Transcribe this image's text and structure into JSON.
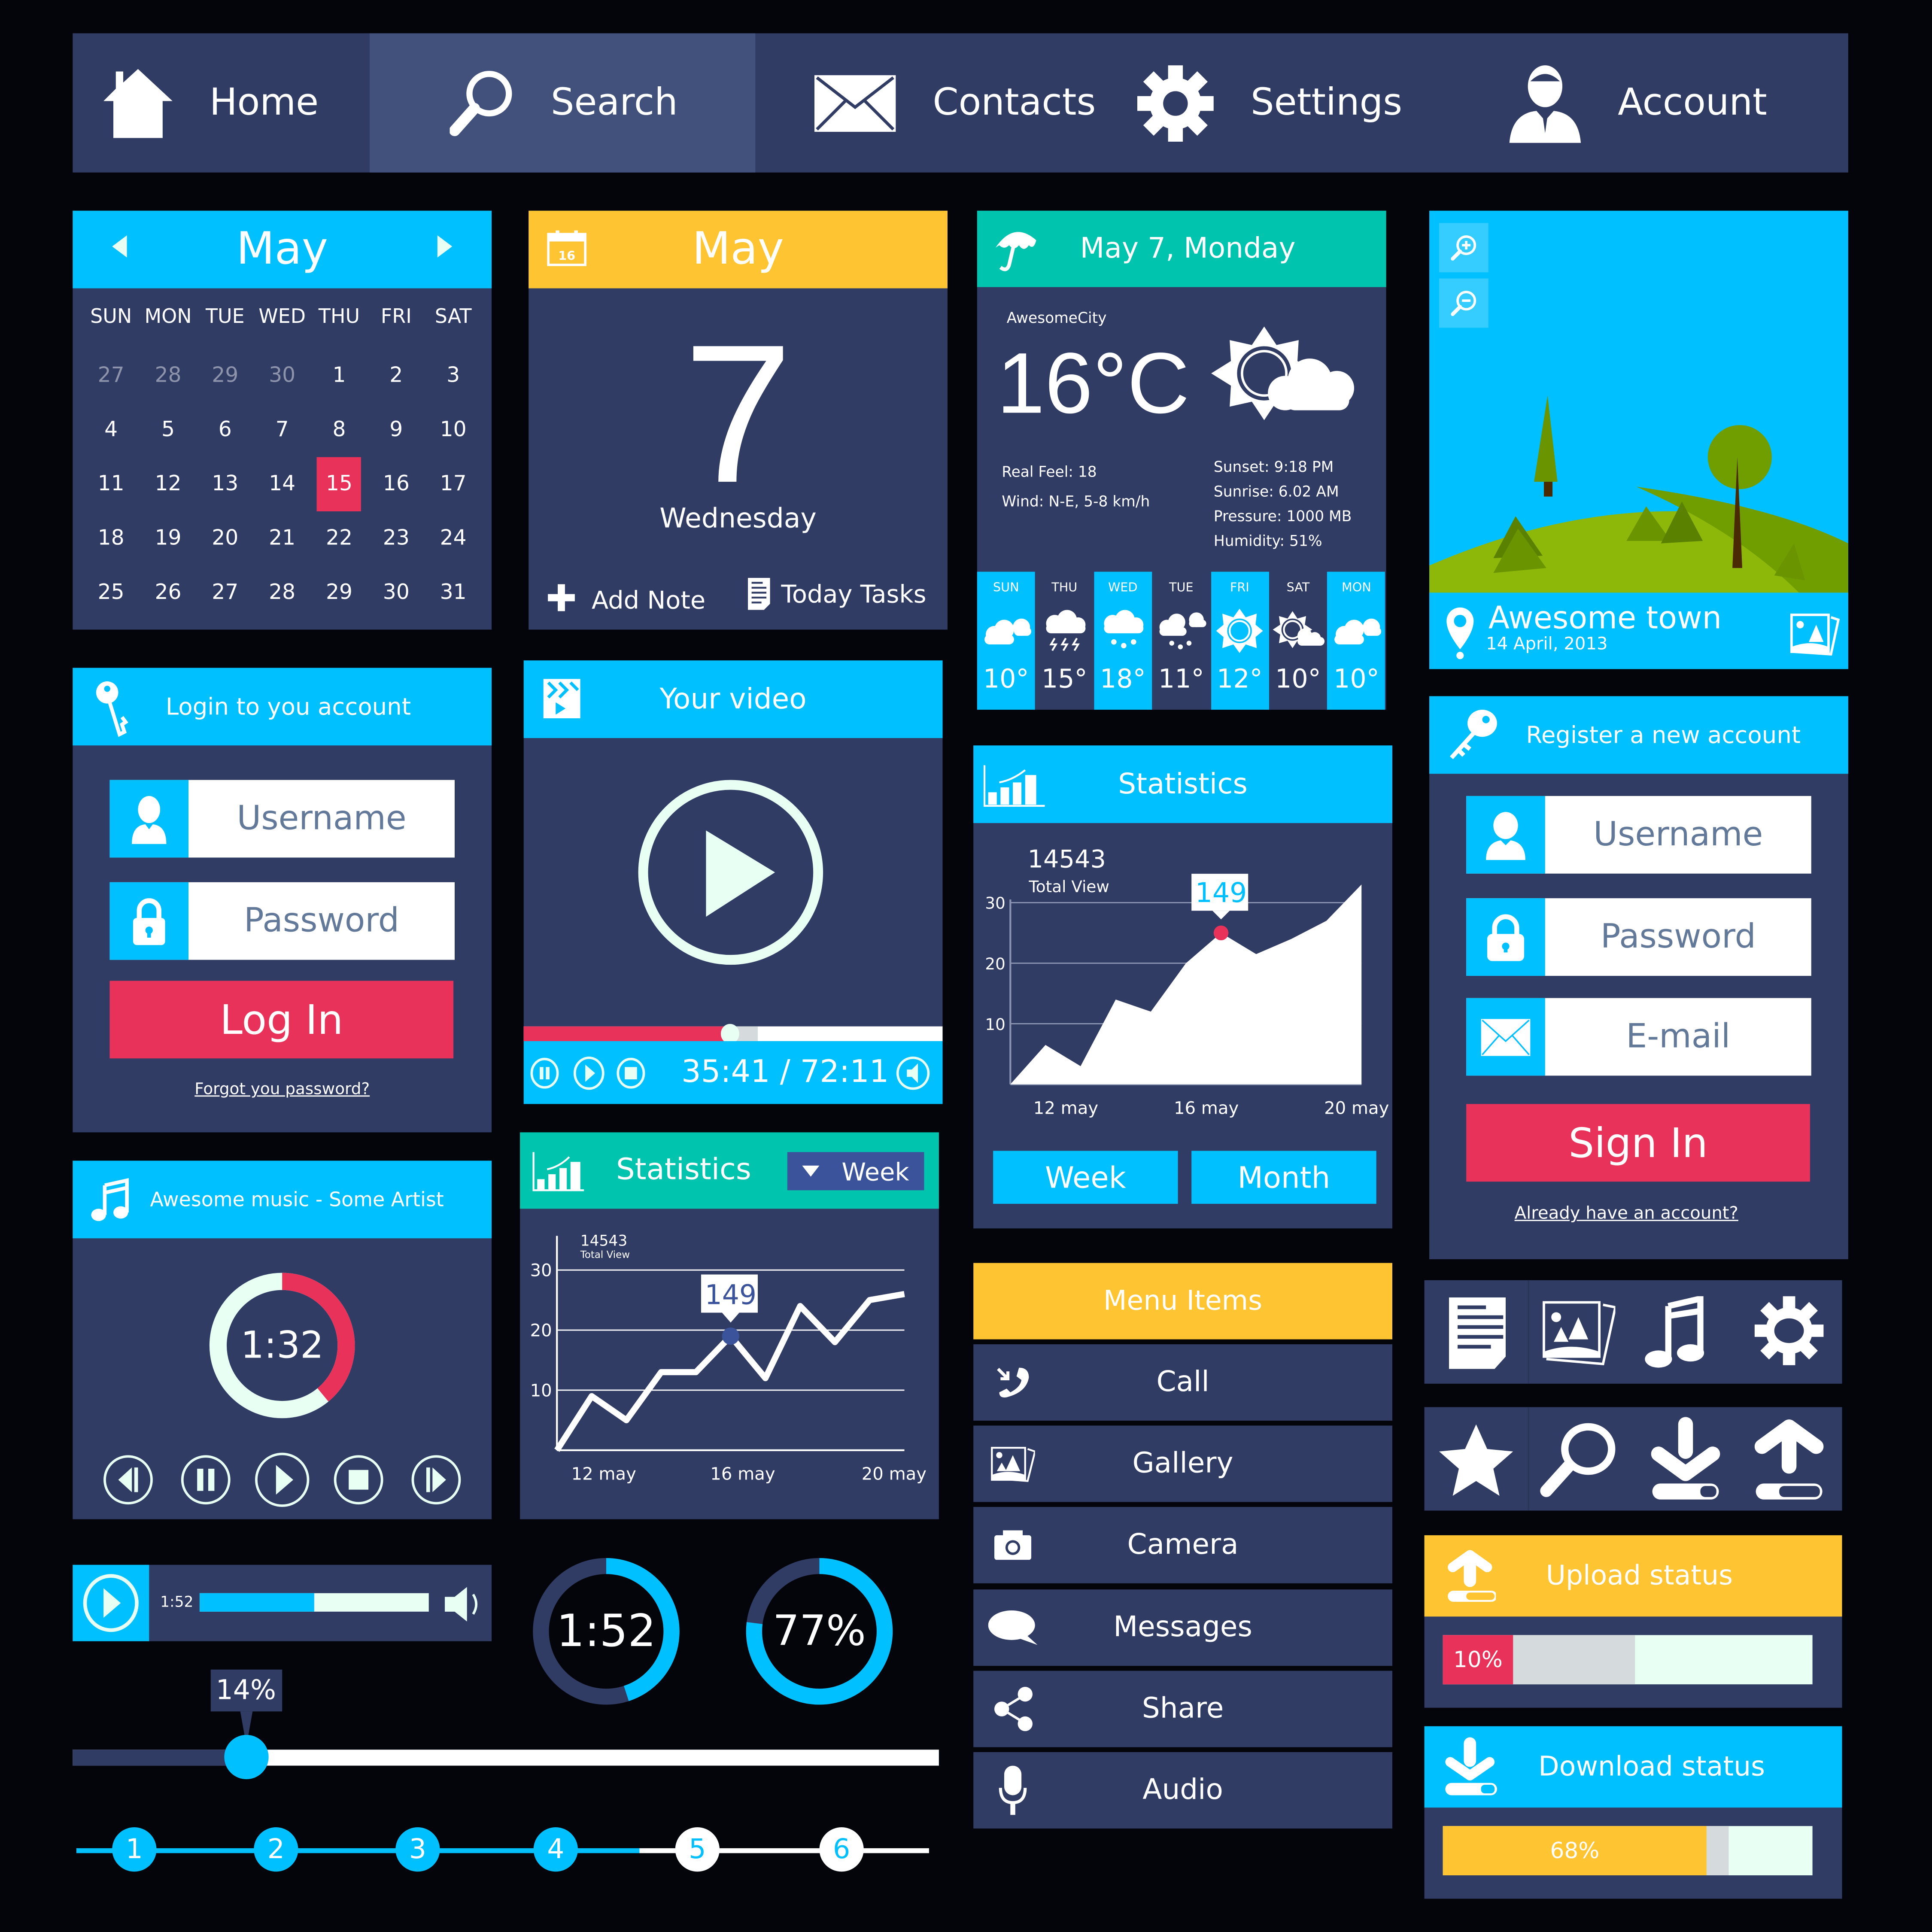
{
  "nav": {
    "items": [
      {
        "label": "Home",
        "icon": "home-icon",
        "active": false
      },
      {
        "label": "Search",
        "icon": "search-icon",
        "active": true
      },
      {
        "label": "Contacts",
        "icon": "envelope-icon",
        "active": false
      },
      {
        "label": "Settings",
        "icon": "gear-icon",
        "active": false
      },
      {
        "label": "Account",
        "icon": "user-icon",
        "active": false
      }
    ]
  },
  "calendar": {
    "month": "May",
    "weekdays": [
      "SUN",
      "MON",
      "TUE",
      "WED",
      "THU",
      "FRI",
      "SAT"
    ],
    "days": [
      "27",
      "28",
      "29",
      "30",
      "1",
      "2",
      "3",
      "4",
      "5",
      "6",
      "7",
      "8",
      "9",
      "10",
      "11",
      "12",
      "13",
      "14",
      "15",
      "16",
      "17",
      "18",
      "19",
      "20",
      "21",
      "22",
      "23",
      "24",
      "25",
      "26",
      "27",
      "28",
      "29",
      "30",
      "31"
    ],
    "muted_count": 4,
    "selected": "15"
  },
  "day_card": {
    "month": "May",
    "icon_day": "16",
    "day": "7",
    "weekday": "Wednesday",
    "add_note": "Add Note",
    "today_tasks": "Today Tasks"
  },
  "weather": {
    "date": "May 7, Monday",
    "city": "AwesomeCity",
    "temp": "16°C",
    "real_feel": "Real Feel: 18",
    "wind": "Wind: N-E, 5-8 km/h",
    "sunset": "Sunset: 9:18 PM",
    "sunrise": "Sunrise: 6.02 AM",
    "pressure": "Pressure: 1000 MB",
    "humidity": "Humidity: 51%",
    "forecast": [
      {
        "day": "SUN",
        "temp": "10°",
        "icon": "clouds-icon"
      },
      {
        "day": "THU",
        "temp": "15°",
        "icon": "thunderstorm-icon"
      },
      {
        "day": "WED",
        "temp": "18°",
        "icon": "rain-icon"
      },
      {
        "day": "TUE",
        "temp": "11°",
        "icon": "rain-clouds-icon"
      },
      {
        "day": "FRI",
        "temp": "12°",
        "icon": "sun-icon"
      },
      {
        "day": "SAT",
        "temp": "10°",
        "icon": "partly-cloudy-icon"
      },
      {
        "day": "MON",
        "temp": "10°",
        "icon": "clouds-icon"
      }
    ]
  },
  "photo": {
    "title": "Awesome town",
    "date": "14 April, 2013"
  },
  "login": {
    "title": "Login to you account",
    "username_placeholder": "Username",
    "password_placeholder": "Password",
    "button": "Log In",
    "forgot": "Forgot you password?"
  },
  "video": {
    "title": "Your video",
    "time": "35:41 / 72:11",
    "progress": 0.49,
    "buffered": 0.56
  },
  "stats_area": {
    "title": "Statistics",
    "total": "14543",
    "total_label": "Total View",
    "tooltip": "149",
    "week": "Week",
    "month": "Month"
  },
  "register": {
    "title": "Register a new account",
    "username_placeholder": "Username",
    "password_placeholder": "Password",
    "email_placeholder": "E-mail",
    "button": "Sign In",
    "already": "Already have an account?"
  },
  "music": {
    "title": "Awesome music - Some Artist",
    "time": "1:32",
    "progress": 0.39
  },
  "stats_line": {
    "title": "Statistics",
    "dropdown": "Week",
    "total": "14543",
    "total_label": "Total View",
    "tooltip": "149"
  },
  "menu": {
    "title": "Menu Items",
    "items": [
      {
        "label": "Call",
        "icon": "phone-icon"
      },
      {
        "label": "Gallery",
        "icon": "gallery-icon"
      },
      {
        "label": "Camera",
        "icon": "camera-icon"
      },
      {
        "label": "Messages",
        "icon": "speech-bubble-icon"
      },
      {
        "label": "Share",
        "icon": "share-icon"
      },
      {
        "label": "Audio",
        "icon": "microphone-icon"
      }
    ]
  },
  "mini_player": {
    "time": "1:52",
    "progress": 0.5
  },
  "ring_time": {
    "label": "1:52",
    "progress": 0.45
  },
  "ring_percent": {
    "label": "77%",
    "progress": 0.77
  },
  "slider": {
    "label": "14%",
    "value": 0.2
  },
  "stepper": {
    "steps": [
      "1",
      "2",
      "3",
      "4",
      "5",
      "6"
    ],
    "completed": 4
  },
  "upload": {
    "title": "Upload status",
    "label": "10%",
    "value": 0.1
  },
  "download": {
    "title": "Download status",
    "label": "68%",
    "value": 0.68
  },
  "chart_data": [
    {
      "type": "area",
      "title": "Statistics",
      "x": [
        0,
        1,
        2,
        3,
        4,
        5,
        6,
        7,
        8,
        9,
        10
      ],
      "values": [
        0,
        6.5,
        3,
        14,
        12,
        20,
        25,
        21.5,
        24,
        27,
        33
      ],
      "xticks": [
        "12 may",
        "16 may",
        "20 may"
      ],
      "yticks": [
        10,
        20,
        30
      ],
      "ylim": [
        0,
        35
      ],
      "highlight": {
        "index": 6,
        "label": "149"
      }
    },
    {
      "type": "line",
      "title": "Statistics",
      "x": [
        0,
        1,
        2,
        3,
        4,
        5,
        6,
        7,
        8,
        9,
        10,
        11
      ],
      "values": [
        0,
        9,
        5,
        13,
        13,
        19,
        12,
        24,
        18,
        25,
        26
      ],
      "xticks": [
        "12 may",
        "16 may",
        "20 may"
      ],
      "yticks": [
        10,
        20,
        30
      ],
      "ylim": [
        0,
        32
      ],
      "highlight": {
        "index": 5,
        "label": "149"
      }
    }
  ]
}
